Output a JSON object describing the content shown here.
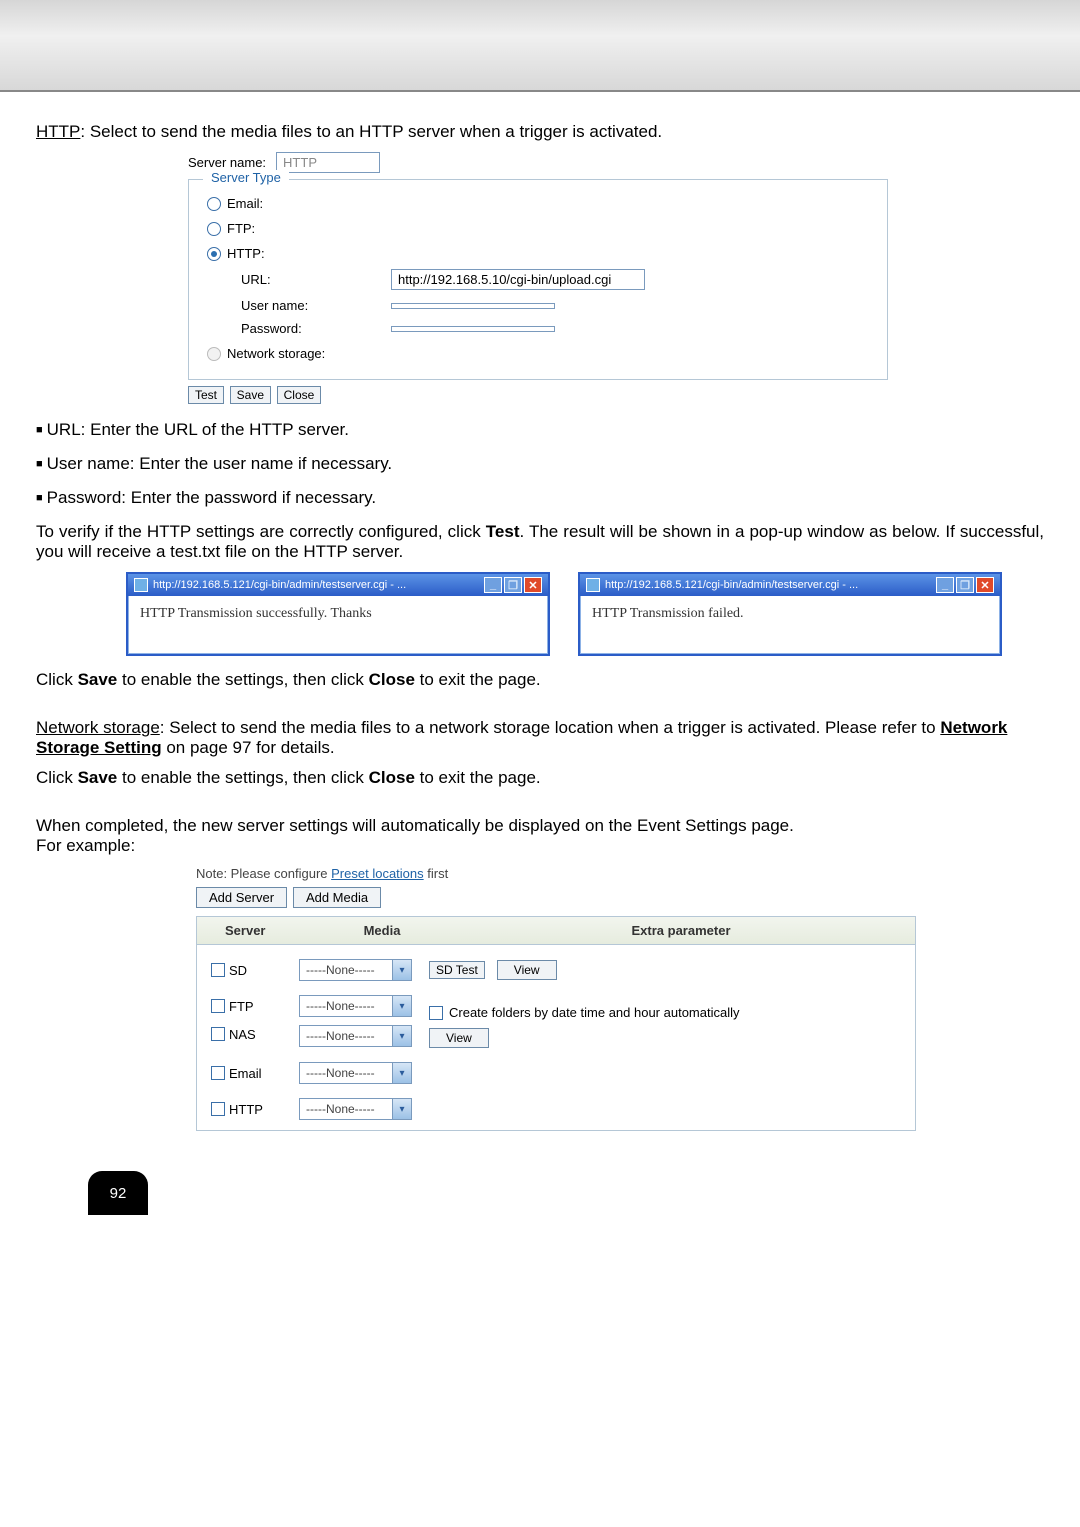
{
  "intro": {
    "http_label": "HTTP",
    "http_desc": ": Select to send the media files to an HTTP server when a trigger is activated."
  },
  "server_form": {
    "server_name_label": "Server name:",
    "server_name_value": "HTTP",
    "legend": "Server Type",
    "radio_email": "Email:",
    "radio_ftp": "FTP:",
    "radio_http": "HTTP:",
    "url_label": "URL:",
    "url_value": "http://192.168.5.10/cgi-bin/upload.cgi",
    "username_label": "User name:",
    "username_value": "",
    "password_label": "Password:",
    "password_value": "",
    "radio_network": "Network storage:",
    "btn_test": "Test",
    "btn_save": "Save",
    "btn_close": "Close"
  },
  "bullets": {
    "b1": "URL: Enter the URL of the HTTP server.",
    "b2": "User name: Enter the user name if necessary.",
    "b3": "Password: Enter the password if necessary."
  },
  "verify": {
    "p1a": "To verify if the HTTP settings are correctly configured, click ",
    "p1b": "Test",
    "p1c": ". The result will be shown in a pop-up window as below. If successful, you will receive a test.txt file on the HTTP server."
  },
  "popups": {
    "title_left": "http://192.168.5.121/cgi-bin/admin/testserver.cgi - ...",
    "body_left": "HTTP Transmission successfully. Thanks",
    "title_right": "http://192.168.5.121/cgi-bin/admin/testserver.cgi - ...",
    "body_right": "HTTP Transmission failed."
  },
  "after_popups": {
    "p1a": "Click ",
    "p1b": "Save",
    "p1c": " to enable the settings, then click ",
    "p1d": "Close",
    "p1e": " to exit the page."
  },
  "network_storage": {
    "label": "Network storage",
    "desc": ": Select to send the media files to a network storage location when a trigger is activated. Please refer to ",
    "link": "Network Storage Setting",
    "desc2": " on page 97 for details."
  },
  "after_ns": {
    "p1a": "Click ",
    "p1b": "Save",
    "p1c": " to enable the settings, then click ",
    "p1d": "Close",
    "p1e": " to exit the page."
  },
  "completed": {
    "line1": "When completed, the new server settings will automatically be displayed on the Event Settings page.",
    "line2": "For example:"
  },
  "event_panel": {
    "note_a": "Note: Please configure ",
    "note_link": "Preset locations",
    "note_b": " first",
    "btn_add_server": "Add Server",
    "btn_add_media": "Add Media",
    "head_server": "Server",
    "head_media": "Media",
    "head_extra": "Extra parameter",
    "rows": {
      "sd": "SD",
      "ftp": "FTP",
      "nas": "NAS",
      "email": "Email",
      "http": "HTTP"
    },
    "dropdown_none": "-----None-----",
    "btn_sd_test": "SD Test",
    "btn_view": "View",
    "folders_label": "Create folders by date time and hour automatically"
  },
  "page_number": "92",
  "icons": {
    "down": "▾",
    "min": "_",
    "max": "❐",
    "close": "✕"
  }
}
